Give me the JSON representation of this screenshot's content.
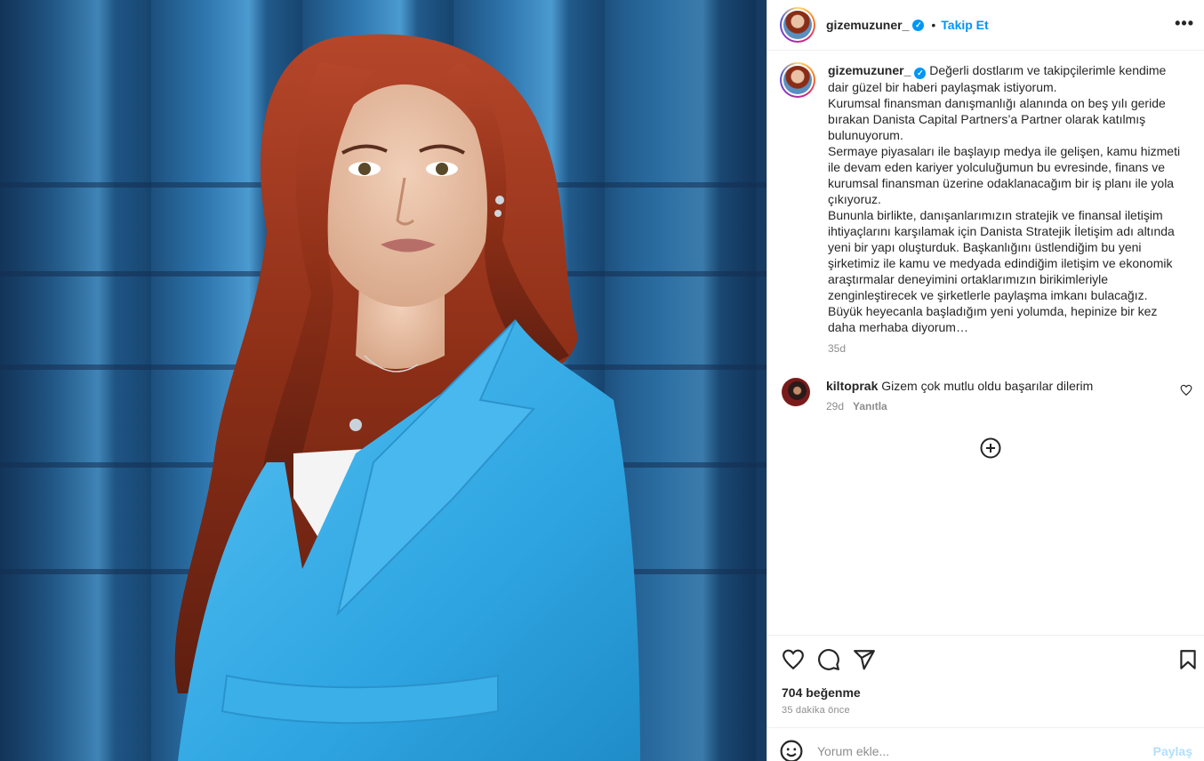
{
  "post": {
    "image_alt": "Portrait photo of a woman with long red hair wearing a light blue blazer in front of a glass building"
  },
  "header": {
    "username": "gizemuzuner_",
    "verified_icon": "verified-badge-icon",
    "dot": "•",
    "follow_label": "Takip Et",
    "more_label": "•••"
  },
  "caption": {
    "username": "gizemuzuner_",
    "text": "Değerli dostlarım ve takipçilerimle kendime dair güzel bir haberi paylaşmak istiyorum.\nKurumsal finansman danışmanlığı alanında on beş yılı geride bırakan Danista Capital Partners’a Partner olarak katılmış bulunuyorum.\nSermaye piyasaları ile başlayıp medya ile gelişen, kamu hizmeti ile devam eden kariyer yolculuğumun bu evresinde, finans ve kurumsal finansman üzerine odaklanacağım bir iş planı ile yola çıkıyoruz.\nBununla birlikte, danışanlarımızın stratejik ve finansal iletişim ihtiyaçlarını karşılamak için Danista Stratejik İletişim adı altında yeni bir yapı oluşturduk. Başkanlığını üstlendiğim bu yeni şirketimiz ile kamu ve medyada edindiğim iletişim ve ekonomik araştırmalar deneyimini ortaklarımızın birikimleriyle zenginleştirecek ve şirketlerle paylaşma imkanı bulacağız.\nBüyük heyecanla başladığım yeni yolumda, hepinize bir kez daha merhaba diyorum…",
    "time": "35d"
  },
  "comments": [
    {
      "username": "kiltoprak",
      "text": "Gizem çok mutlu oldu başarılar dilerim",
      "time": "29d",
      "reply_label": "Yanıtla"
    }
  ],
  "actions": {
    "likes": "704 beğenme",
    "age": "35 dakika önce"
  },
  "comment_box": {
    "placeholder": "Yorum ekle...",
    "post_label": "Paylaş"
  },
  "colors": {
    "accent": "#0095f6",
    "blazer": "#3db1ea",
    "hair": "#9a3418"
  }
}
